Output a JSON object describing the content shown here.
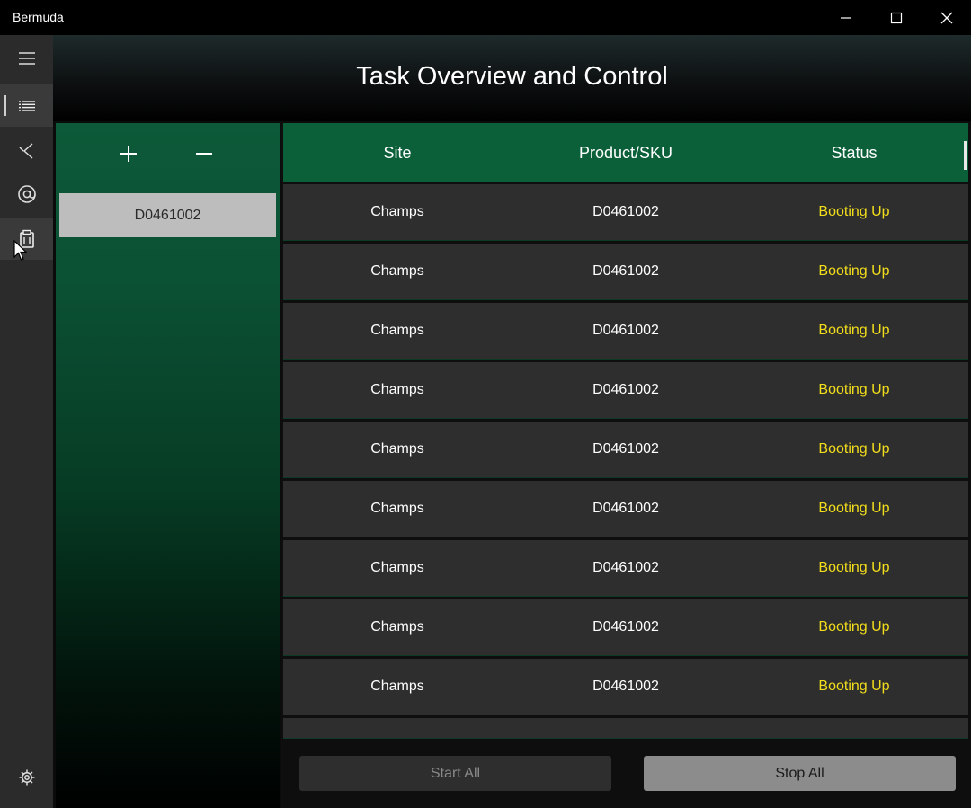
{
  "window": {
    "title": "Bermuda",
    "controls": [
      "minimize-icon",
      "maximize-icon",
      "close-icon"
    ]
  },
  "sidebar": {
    "items": [
      {
        "icon": "hamburger-menu-icon"
      },
      {
        "icon": "task-list-icon",
        "selected": true
      },
      {
        "icon": "proxy-icon"
      },
      {
        "icon": "at-sign-icon"
      },
      {
        "icon": "clipboard-icon"
      },
      {
        "icon": "gear-icon"
      }
    ]
  },
  "header": {
    "title": "Task Overview and Control"
  },
  "task_panel": {
    "add_icon": "plus-icon",
    "remove_icon": "minus-icon",
    "items": [
      {
        "label": "D0461002"
      }
    ]
  },
  "table": {
    "columns": [
      "Site",
      "Product/SKU",
      "Status"
    ],
    "rows": [
      {
        "site": "Champs",
        "sku": "D0461002",
        "status": "Booting Up"
      },
      {
        "site": "Champs",
        "sku": "D0461002",
        "status": "Booting Up"
      },
      {
        "site": "Champs",
        "sku": "D0461002",
        "status": "Booting Up"
      },
      {
        "site": "Champs",
        "sku": "D0461002",
        "status": "Booting Up"
      },
      {
        "site": "Champs",
        "sku": "D0461002",
        "status": "Booting Up"
      },
      {
        "site": "Champs",
        "sku": "D0461002",
        "status": "Booting Up"
      },
      {
        "site": "Champs",
        "sku": "D0461002",
        "status": "Booting Up"
      },
      {
        "site": "Champs",
        "sku": "D0461002",
        "status": "Booting Up"
      },
      {
        "site": "Champs",
        "sku": "D0461002",
        "status": "Booting Up"
      }
    ]
  },
  "footer": {
    "start_label": "Start All",
    "stop_label": "Stop All"
  },
  "colors": {
    "accent_green": "#0b6039",
    "status_yellow": "#f2dd1b",
    "row_bg": "#2e2e2e"
  }
}
